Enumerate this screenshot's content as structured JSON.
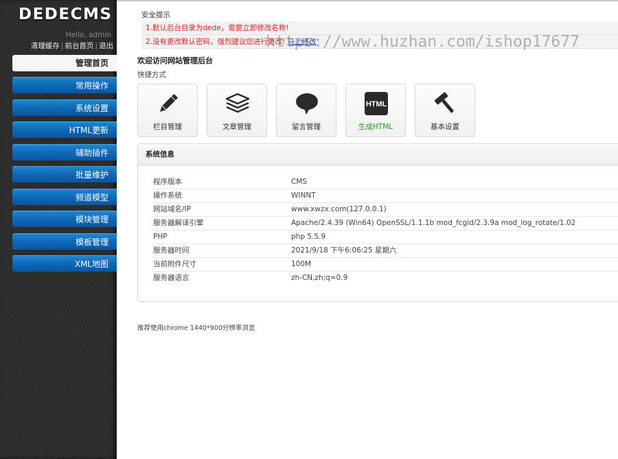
{
  "sidebar": {
    "logo": "DEDECMS",
    "hello": "Hello, admin",
    "links": [
      "清理缓存",
      "前台首页",
      "退出"
    ],
    "separator": "|",
    "nav": [
      {
        "label": "管理首页",
        "active": true
      },
      {
        "label": "常用操作",
        "active": false
      },
      {
        "label": "系统设置",
        "active": false
      },
      {
        "label": "HTML更新",
        "active": false
      },
      {
        "label": "辅助插件",
        "active": false
      },
      {
        "label": "批量维护",
        "active": false
      },
      {
        "label": "频道模型",
        "active": false
      },
      {
        "label": "模块管理",
        "active": false
      },
      {
        "label": "模板管理",
        "active": false
      },
      {
        "label": "XML地图",
        "active": false
      }
    ]
  },
  "main": {
    "safety_title": "安全提示",
    "warnings": [
      {
        "text": "1.默认后台目录为dede，需要立即修改名称!",
        "link": ""
      },
      {
        "text": "2.没有更改默认密码，强烈建议您进行更改! ",
        "link": "马上修改"
      }
    ],
    "welcome": "欢迎访问网站管理后台",
    "shortcuts_label": "快捷方式",
    "shortcuts": [
      {
        "label": "栏目管理",
        "icon": "pencil-icon"
      },
      {
        "label": "文章管理",
        "icon": "stack-icon"
      },
      {
        "label": "留言管理",
        "icon": "speech-bubble-icon"
      },
      {
        "label": "生成HTML",
        "icon": "html-icon",
        "icon_text": "HTML"
      },
      {
        "label": "基本设置",
        "icon": "hammer-icon"
      }
    ],
    "sys_title": "系统信息",
    "sys_rows": [
      {
        "key": "程序版本",
        "value": "CMS"
      },
      {
        "key": "操作系统",
        "value": "WINNT"
      },
      {
        "key": "网站域名/IP",
        "value": "www.xwzx.com(127.0.0.1)"
      },
      {
        "key": "服务器解译引擎",
        "value": "Apache/2.4.39 (Win64) OpenSSL/1.1.1b mod_fcgid/2.3.9a mod_log_rotate/1.02"
      },
      {
        "key": "PHP",
        "value": "php 5.5.9"
      },
      {
        "key": "服务器时间",
        "value": "2021/9/18 下午6:06:25 星期六"
      },
      {
        "key": "当前附件尺寸",
        "value": "100M"
      },
      {
        "key": "服务器语言",
        "value": "zh-CN,zh;q=0.9"
      }
    ],
    "footer_note": "推荐使用chrome 1440*900分辨率浏览",
    "watermark": "https://www.huzhan.com/ishop17677"
  },
  "colors": {
    "sidebar_bg": "#2b2b2b",
    "nav_blue": "#0f6ab9",
    "warning_red": "#e02020",
    "highlight_green": "#2a9a2a"
  }
}
